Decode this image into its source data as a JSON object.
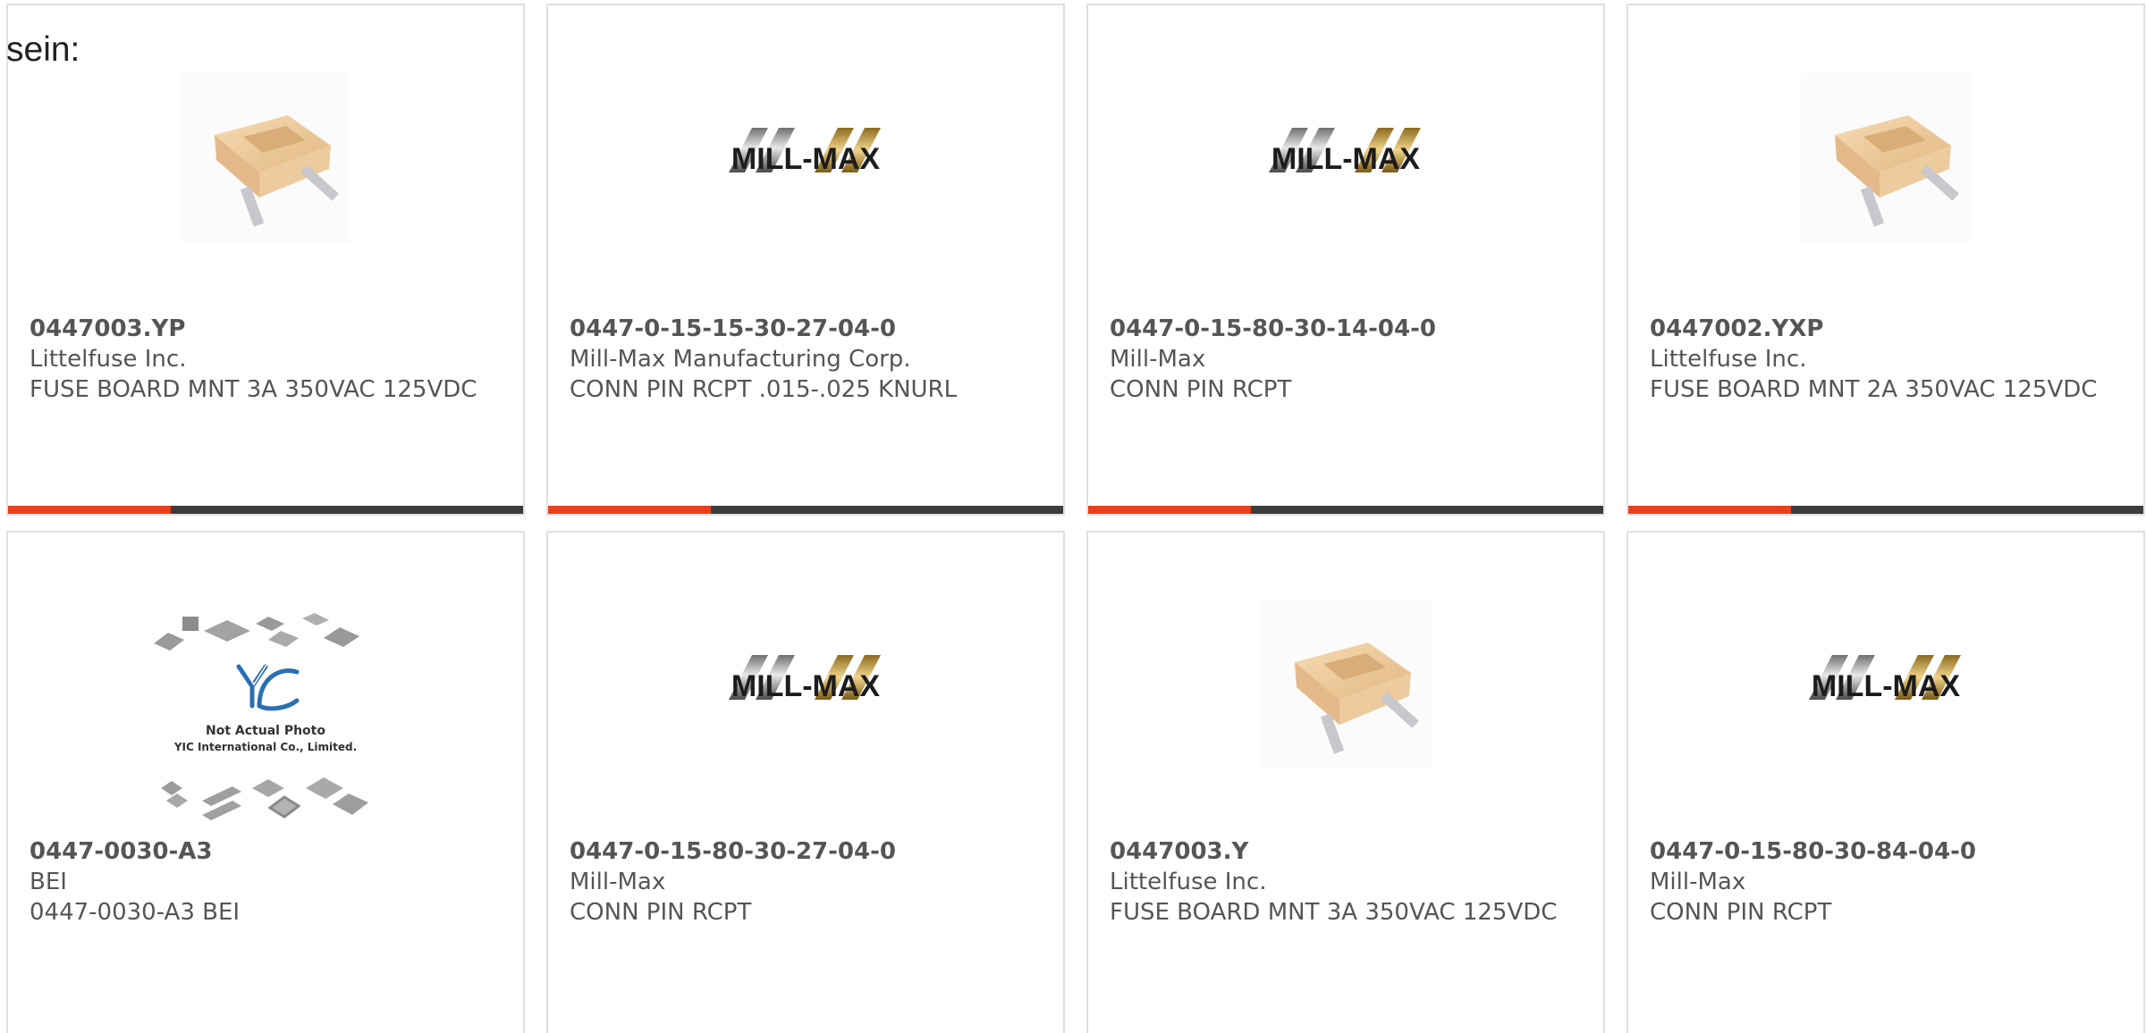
{
  "page": {
    "lead_text": "sein:"
  },
  "colors": {
    "card_border": "#e0e0e0",
    "bar_accent": "#e8401c",
    "bar_base": "#3c3c3c",
    "text": "#555555"
  },
  "products": [
    {
      "part_number": "0447003.YP",
      "manufacturer": "Littelfuse Inc.",
      "description": "FUSE BOARD MNT 3A 350VAC 125VDC",
      "image_icon": "fuse-product-icon"
    },
    {
      "part_number": "0447-0-15-15-30-27-04-0",
      "manufacturer": "Mill-Max Manufacturing Corp.",
      "description": "CONN PIN RCPT .015-.025 KNURL",
      "image_icon": "mill-max-logo-icon",
      "logo_text": "MILL-MAX"
    },
    {
      "part_number": "0447-0-15-80-30-14-04-0",
      "manufacturer": "Mill-Max",
      "description": "CONN PIN RCPT",
      "image_icon": "mill-max-logo-icon",
      "logo_text": "MILL-MAX"
    },
    {
      "part_number": "0447002.YXP",
      "manufacturer": "Littelfuse Inc.",
      "description": "FUSE BOARD MNT 2A 350VAC 125VDC",
      "image_icon": "fuse-product-icon"
    },
    {
      "part_number": "0447-0030-A3",
      "manufacturer": "BEI",
      "description": "0447-0030-A3 BEI",
      "image_icon": "yic-placeholder-icon",
      "placeholder_line1": "Not Actual Photo",
      "placeholder_line2": "YIC International Co., Limited."
    },
    {
      "part_number": "0447-0-15-80-30-27-04-0",
      "manufacturer": "Mill-Max",
      "description": "CONN PIN RCPT",
      "image_icon": "mill-max-logo-icon",
      "logo_text": "MILL-MAX"
    },
    {
      "part_number": "0447003.Y",
      "manufacturer": "Littelfuse Inc.",
      "description": "FUSE BOARD MNT 3A 350VAC 125VDC",
      "image_icon": "fuse-product-icon"
    },
    {
      "part_number": "0447-0-15-80-30-84-04-0",
      "manufacturer": "Mill-Max",
      "description": "CONN PIN RCPT",
      "image_icon": "mill-max-logo-icon",
      "logo_text": "MILL-MAX"
    }
  ]
}
